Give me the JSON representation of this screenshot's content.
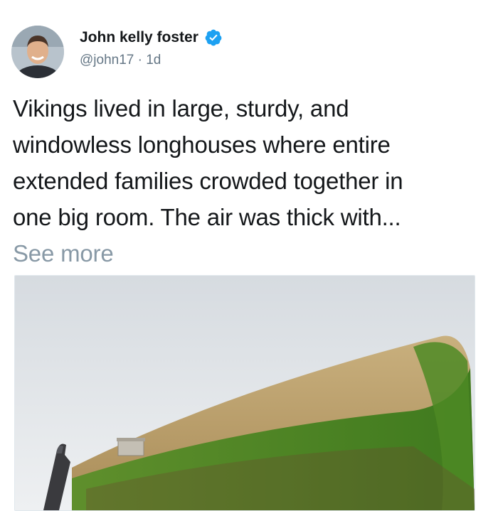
{
  "tweet": {
    "author": {
      "name": "John kelly foster",
      "handle": "@john17",
      "time": "1d",
      "separator": " · "
    },
    "text_lines": [
      "Vikings lived in large, sturdy, and",
      "windowless longhouses where entire",
      "extended families crowded together in",
      "one big room. The air was thick with..."
    ],
    "see_more": "See more",
    "icons": {
      "verified": "verified-badge-icon",
      "avatar": "avatar-photo"
    },
    "colors": {
      "verified": "#1da1f2",
      "secondary_text": "#657786",
      "see_more": "#8899a6"
    }
  }
}
